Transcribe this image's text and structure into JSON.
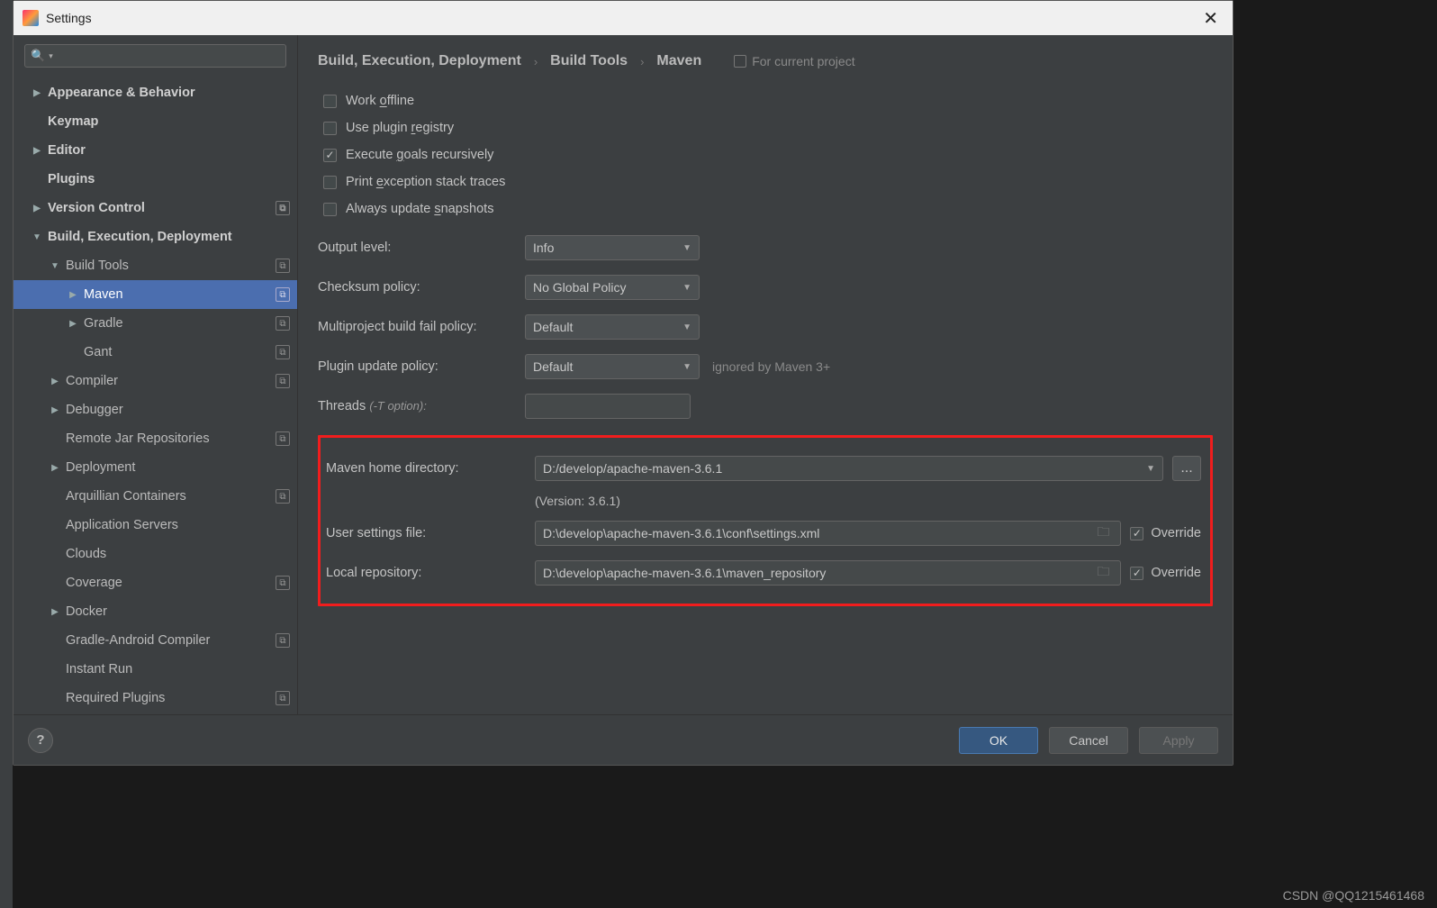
{
  "titlebar": {
    "title": "Settings"
  },
  "breadcrumb": {
    "a": "Build, Execution, Deployment",
    "b": "Build Tools",
    "c": "Maven",
    "for_project": "For current project"
  },
  "sidebar": {
    "items": [
      {
        "label": "Appearance & Behavior"
      },
      {
        "label": "Keymap"
      },
      {
        "label": "Editor"
      },
      {
        "label": "Plugins"
      },
      {
        "label": "Version Control"
      },
      {
        "label": "Build, Execution, Deployment"
      },
      {
        "label": "Build Tools"
      },
      {
        "label": "Maven"
      },
      {
        "label": "Gradle"
      },
      {
        "label": "Gant"
      },
      {
        "label": "Compiler"
      },
      {
        "label": "Debugger"
      },
      {
        "label": "Remote Jar Repositories"
      },
      {
        "label": "Deployment"
      },
      {
        "label": "Arquillian Containers"
      },
      {
        "label": "Application Servers"
      },
      {
        "label": "Clouds"
      },
      {
        "label": "Coverage"
      },
      {
        "label": "Docker"
      },
      {
        "label": "Gradle-Android Compiler"
      },
      {
        "label": "Instant Run"
      },
      {
        "label": "Required Plugins"
      }
    ]
  },
  "checks": {
    "work_offline": "Work offline",
    "use_plugin": "Use plugin registry",
    "exec_goals": "Execute goals recursively",
    "print_exc": "Print exception stack traces",
    "always_update": "Always update snapshots"
  },
  "fields": {
    "output_level_label": "Output level:",
    "output_level_value": "Info",
    "checksum_label": "Checksum policy:",
    "checksum_value": "No Global Policy",
    "multiproj_label": "Multiproject build fail policy:",
    "multiproj_value": "Default",
    "plugin_update_label": "Plugin update policy:",
    "plugin_update_value": "Default",
    "plugin_update_note": "ignored by Maven 3+",
    "threads_label": "Threads ",
    "threads_hint": "(-T option):",
    "threads_value": ""
  },
  "paths": {
    "maven_home_label": "Maven home directory:",
    "maven_home_value": "D:/develop/apache-maven-3.6.1",
    "version_note": "(Version: 3.6.1)",
    "user_settings_label": "User settings file:",
    "user_settings_value": "D:\\develop\\apache-maven-3.6.1\\conf\\settings.xml",
    "local_repo_label": "Local repository:",
    "local_repo_value": "D:\\develop\\apache-maven-3.6.1\\maven_repository",
    "override": "Override",
    "ellipsis": "..."
  },
  "footer": {
    "ok": "OK",
    "cancel": "Cancel",
    "apply": "Apply"
  },
  "watermark": "CSDN @QQ1215461468"
}
